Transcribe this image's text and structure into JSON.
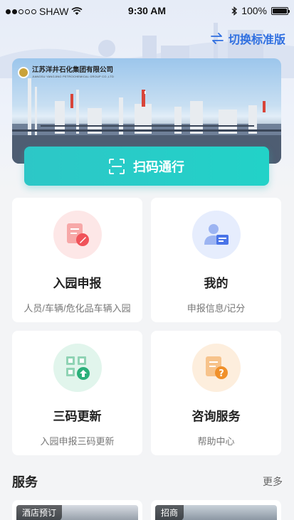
{
  "status_bar": {
    "carrier": "SHAW",
    "time": "9:30 AM",
    "battery": "100%"
  },
  "header": {
    "switch_label": "切换标准版"
  },
  "banner": {
    "company_name": "江苏洋井石化集团有限公司",
    "company_name_en": "JIANGSU YANGJING PETROCHEMICAL GROUP CO.,LTD"
  },
  "scan_button": {
    "label": "扫码通行"
  },
  "cards": [
    {
      "title": "入园申报",
      "subtitle": "人员/车辆/危化品车辆入园",
      "icon": "declaration-icon",
      "color": "#f0535a"
    },
    {
      "title": "我的",
      "subtitle": "申报信息/记分",
      "icon": "user-profile-icon",
      "color": "#4a74e8"
    },
    {
      "title": "三码更新",
      "subtitle": "入园申报三码更新",
      "icon": "qr-update-icon",
      "color": "#2bb07a"
    },
    {
      "title": "咨询服务",
      "subtitle": "帮助中心",
      "icon": "help-doc-icon",
      "color": "#f0902a"
    }
  ],
  "services": {
    "title": "服务",
    "more_label": "更多",
    "items": [
      {
        "tag": "酒店预订"
      },
      {
        "tag": "招商"
      }
    ]
  },
  "colors": {
    "accent_blue": "#2f6fe0",
    "scan_teal": "#2dc7c7"
  }
}
